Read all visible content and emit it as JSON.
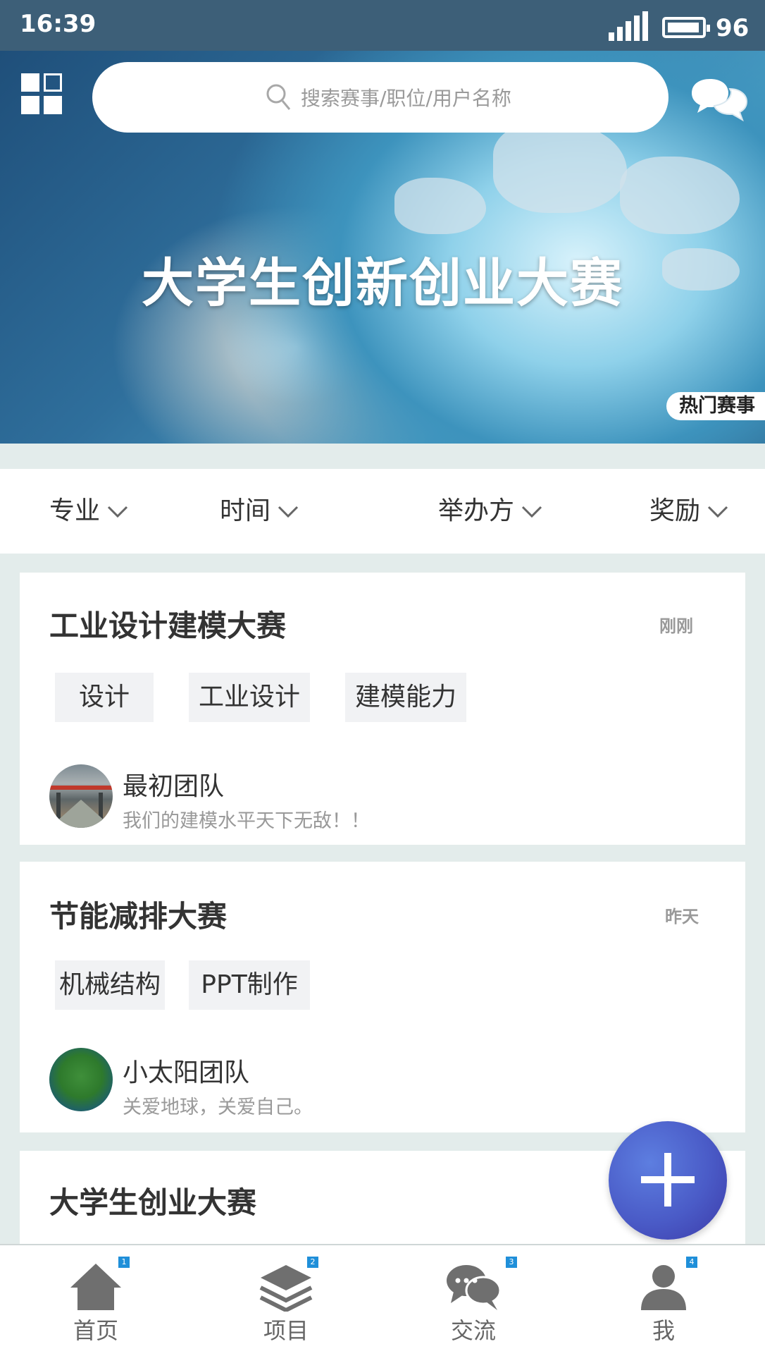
{
  "status_bar": {
    "time": "16:39",
    "battery": "96"
  },
  "header": {
    "search_placeholder": "搜索赛事/职位/用户名称"
  },
  "banner": {
    "title": "大学生创新创业大赛",
    "tag": "热门赛事"
  },
  "filters": [
    {
      "label": "专业"
    },
    {
      "label": "时间"
    },
    {
      "label": "举办方"
    },
    {
      "label": "奖励"
    }
  ],
  "cards": [
    {
      "title": "工业设计建模大赛",
      "time": "刚刚",
      "tags": [
        "设计",
        "工业设计",
        "建模能力"
      ],
      "team": "最初团队",
      "motto": "我们的建模水平天下无敌！！"
    },
    {
      "title": "节能减排大赛",
      "time": "昨天",
      "tags": [
        "机械结构",
        "PPT制作"
      ],
      "team": "小太阳团队",
      "motto": "关爱地球，关爱自己。"
    },
    {
      "title": "大学生创业大赛"
    }
  ],
  "tabbar": [
    {
      "label": "首页",
      "badge": "1",
      "icon": "home-icon"
    },
    {
      "label": "项目",
      "badge": "2",
      "icon": "layers-icon"
    },
    {
      "label": "交流",
      "badge": "3",
      "icon": "chat-icon"
    },
    {
      "label": "我",
      "badge": "4",
      "icon": "user-icon"
    }
  ],
  "colors": {
    "status_bar": "#3d5f78",
    "fab": "#4a5bc7",
    "badge": "#1f8fd9"
  }
}
